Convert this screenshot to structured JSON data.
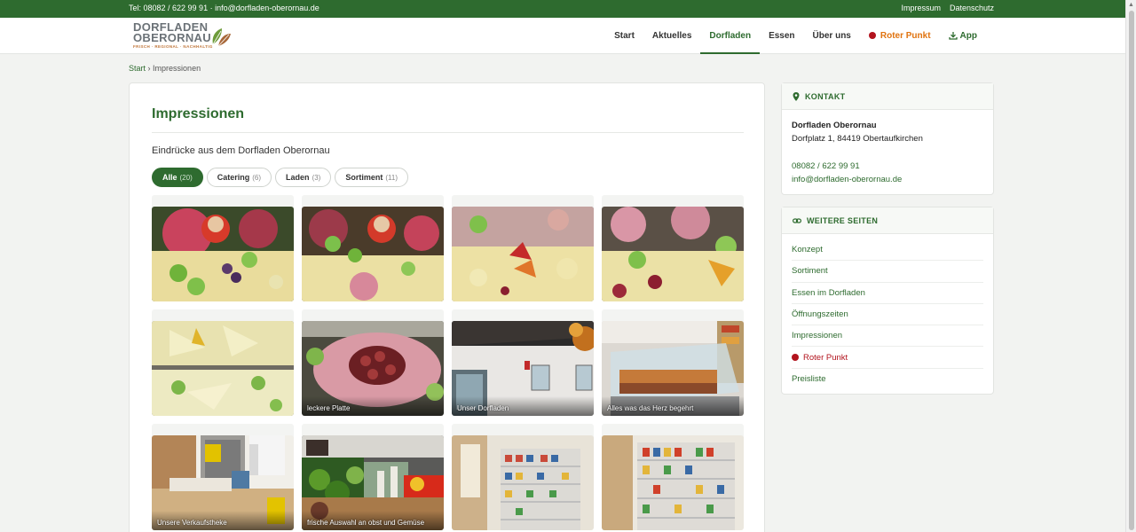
{
  "topbar": {
    "contact": "Tel: 08082 / 622 99 91 · info@dorfladen-oberornau.de",
    "links": [
      "Impressum",
      "Datenschutz"
    ]
  },
  "logo": {
    "line1": "DORFLADEN",
    "line2": "OBERORNAU",
    "tagline": "FRISCH · REGIONAL · NACHHALTIG"
  },
  "nav": {
    "items": [
      "Start",
      "Aktuelles",
      "Dorfladen",
      "Essen",
      "Über uns"
    ],
    "active": "Dorfladen",
    "roter_punkt": "Roter Punkt",
    "app": "App"
  },
  "breadcrumb": {
    "home": "Start",
    "separator": "›",
    "current": "Impressionen"
  },
  "main": {
    "title": "Impressionen",
    "intro": "Eindrücke aus dem Dorfladen Oberornau",
    "filters": [
      {
        "label": "Alle",
        "count": "(20)",
        "active": true
      },
      {
        "label": "Catering",
        "count": "(6)",
        "active": false
      },
      {
        "label": "Laden",
        "count": "(3)",
        "active": false
      },
      {
        "label": "Sortiment",
        "count": "(11)",
        "active": false
      }
    ],
    "gallery": [
      {
        "caption": "",
        "kind": "platter1"
      },
      {
        "caption": "",
        "kind": "platter2"
      },
      {
        "caption": "",
        "kind": "platter3"
      },
      {
        "caption": "",
        "kind": "platter4"
      },
      {
        "caption": "",
        "kind": "cheese"
      },
      {
        "caption": "leckere Platte",
        "kind": "salami"
      },
      {
        "caption": "Unser Dorfladen",
        "kind": "storefront"
      },
      {
        "caption": "Alles was das Herz begehrt",
        "kind": "counter"
      },
      {
        "caption": "Unsere Verkaufstheke",
        "kind": "checkout"
      },
      {
        "caption": "frische Auswahl an obst und Gemüse",
        "kind": "produce"
      },
      {
        "caption": "",
        "kind": "shelves1"
      },
      {
        "caption": "",
        "kind": "shelves2"
      }
    ]
  },
  "kontakt": {
    "heading": "KONTAKT",
    "name": "Dorfladen Oberornau",
    "address": "Dorfplatz 1, 84419 Obertaufkirchen",
    "phone": "08082 / 622 99 91",
    "email": "info@dorfladen-oberornau.de"
  },
  "weitere": {
    "heading": "WEITERE SEITEN",
    "links": [
      "Konzept",
      "Sortiment",
      "Essen im Dorfladen",
      "Öffnungszeiten",
      "Impressionen",
      "Roter Punkt",
      "Preisliste"
    ]
  },
  "colors": {
    "brand_green": "#2e6b2f",
    "roter_punkt_orange": "#e0730f",
    "roter_punkt_dot": "#b2131d"
  }
}
